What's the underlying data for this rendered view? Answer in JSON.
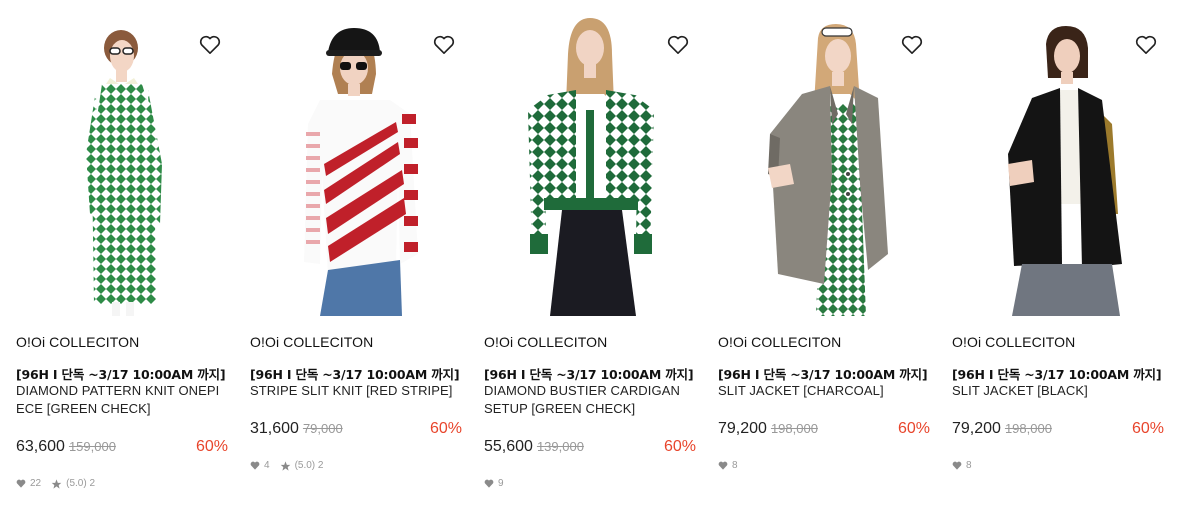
{
  "products": [
    {
      "brand": "O!Oi COLLECITON",
      "promo": "[96H I 단독 ~3/17 10:00AM 까지]",
      "name": "DIAMOND PATTERN KNIT ONEPIECE [GREEN CHECK]",
      "price": "63,600",
      "original_price": "159,000",
      "discount": "60%",
      "likes": "22",
      "rating": "(5.0) 2",
      "photo_main_color": "#2e8b47",
      "image_alt": "Model wearing green diamond knit dress with white sunglasses"
    },
    {
      "brand": "O!Oi COLLECITON",
      "promo": "[96H I 단독 ~3/17 10:00AM 까지]",
      "name": "STRIPE SLIT KNIT [RED STRIPE]",
      "price": "31,600",
      "original_price": "79,000",
      "discount": "60%",
      "likes": "4",
      "rating": "(5.0) 2",
      "photo_main_color": "#c0202a",
      "image_alt": "Model wearing red and white striped knit with black cap"
    },
    {
      "brand": "O!Oi COLLECITON",
      "promo": "[96H I 단독 ~3/17 10:00AM 까지]",
      "name": "DIAMOND BUSTIER CARDIGAN SETUP [GREEN CHECK]",
      "price": "55,600",
      "original_price": "139,000",
      "discount": "60%",
      "likes": "9",
      "rating": "",
      "photo_main_color": "#1f6b3a",
      "image_alt": "Model wearing green diamond cardigan set with black skirt"
    },
    {
      "brand": "O!Oi COLLECITON",
      "promo": "[96H I 단독 ~3/17 10:00AM 까지]",
      "name": "SLIT JACKET [CHARCOAL]",
      "price": "79,200",
      "original_price": "198,000",
      "discount": "60%",
      "likes": "8",
      "rating": "",
      "photo_main_color": "#8a867e",
      "image_alt": "Model wearing charcoal slit jacket over green check dress"
    },
    {
      "brand": "O!Oi COLLECITON",
      "promo": "[96H I 단독 ~3/17 10:00AM 까지]",
      "name": "SLIT JACKET [BLACK]",
      "price": "79,200",
      "original_price": "198,000",
      "discount": "60%",
      "likes": "8",
      "rating": "",
      "photo_main_color": "#151515",
      "image_alt": "Model wearing black slit jacket with jeans"
    }
  ],
  "colors": {
    "discount": "#e8452c",
    "text": "#222222",
    "muted": "#999999"
  },
  "icons": {
    "wishlist": "heart-outline-icon",
    "likes": "heart-small-icon",
    "rating": "star-icon"
  }
}
